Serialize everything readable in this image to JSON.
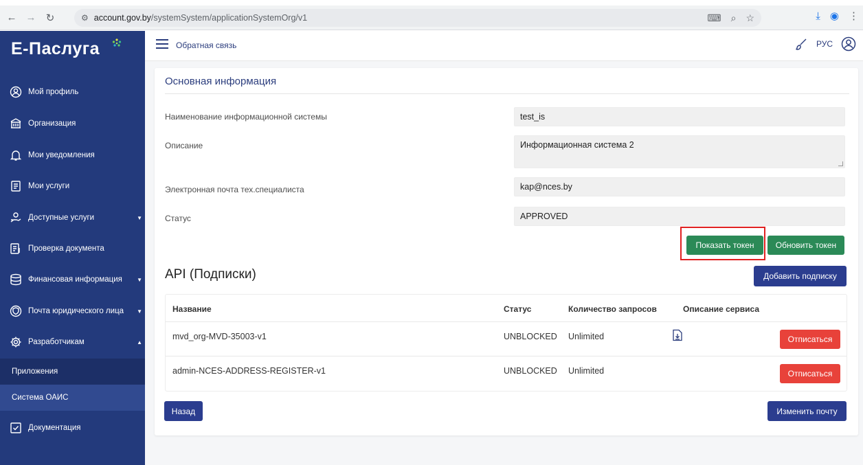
{
  "browser": {
    "url_host": "account.gov.by",
    "url_path": "/systemSystem/applicationSystemOrg/v1"
  },
  "sidebar": {
    "logo": "Е-Паслуга",
    "items": [
      {
        "label": "Мой профиль",
        "icon": "user-circle-icon"
      },
      {
        "label": "Организация",
        "icon": "building-icon"
      },
      {
        "label": "Мои уведомления",
        "icon": "bell-icon"
      },
      {
        "label": "Мои услуги",
        "icon": "services-icon"
      },
      {
        "label": "Доступные услуги",
        "icon": "hand-icon"
      },
      {
        "label": "Проверка документа",
        "icon": "document-check-icon"
      },
      {
        "label": "Финансовая информация",
        "icon": "database-icon"
      },
      {
        "label": "Почта юридического лица",
        "icon": "shield-icon"
      },
      {
        "label": "Разработчикам",
        "icon": "gear-icon"
      }
    ],
    "sub_items": [
      "Приложения",
      "Система ОАИС"
    ],
    "documentation": "Документация"
  },
  "appbar": {
    "feedback": "Обратная связь",
    "lang": "РУС"
  },
  "main": {
    "section_title": "Основная информация",
    "fields": [
      {
        "label": "Наименование информационной системы",
        "value": "test_is"
      },
      {
        "label": "Описание",
        "value": "Информационная система 2"
      },
      {
        "label": "Электронная почта тех.специалиста",
        "value": "kap@nces.by"
      },
      {
        "label": "Статус",
        "value": "APPROVED"
      }
    ],
    "show_token": "Показать токен",
    "refresh_token": "Обновить токен",
    "api_title": "API (Подписки)",
    "add_subscription": "Добавить подписку",
    "table": {
      "headers": [
        "Название",
        "Статус",
        "Количество запросов",
        "Описание сервиса"
      ],
      "rows": [
        {
          "name": "mvd_org-MVD-35003-v1",
          "status": "UNBLOCKED",
          "requests": "Unlimited",
          "has_doc": true,
          "action": "Отписаться"
        },
        {
          "name": "admin-NCES-ADDRESS-REGISTER-v1",
          "status": "UNBLOCKED",
          "requests": "Unlimited",
          "has_doc": false,
          "action": "Отписаться"
        }
      ]
    },
    "back": "Назад",
    "change_email": "Изменить почту"
  },
  "colors": {
    "sidebar": "#233a7c",
    "green": "#2b8a57",
    "navy": "#2b3d8f",
    "red": "#e8423a",
    "highlight": "#e02020"
  }
}
